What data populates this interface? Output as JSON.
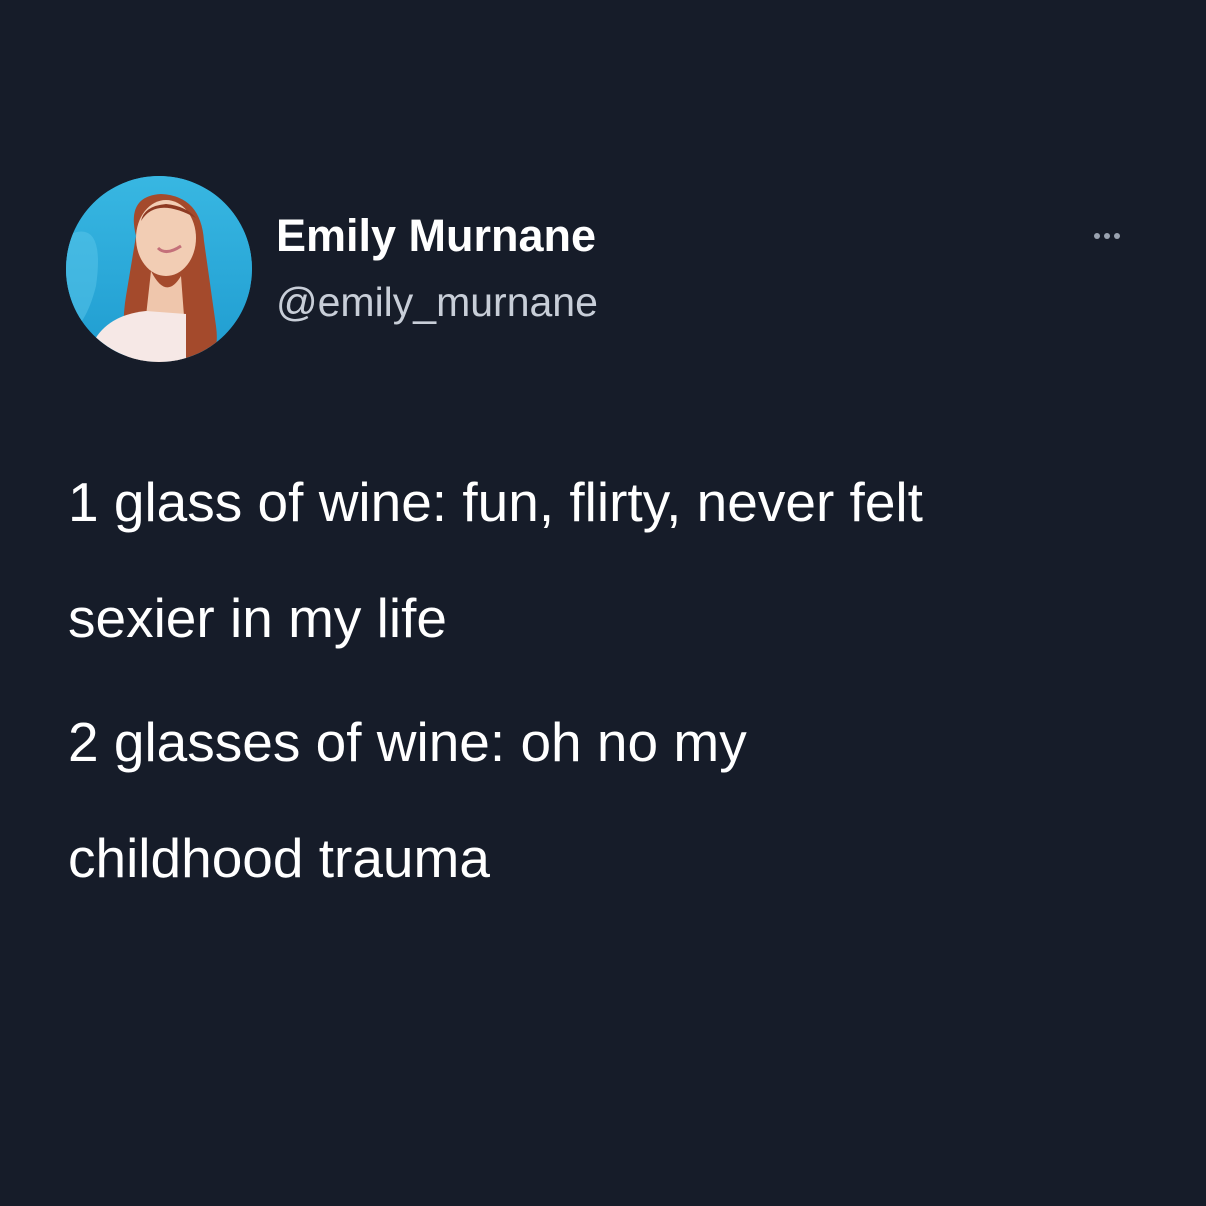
{
  "author": {
    "display_name": "Emily Murnane",
    "handle": "@emily_murnane",
    "avatar_icon": "profile-photo"
  },
  "actions": {
    "more_icon": "ellipsis-icon"
  },
  "tweet": {
    "lines": [
      "1 glass of wine: fun, flirty, never felt",
      "sexier in my life",
      "2 glasses of wine: oh no my",
      "childhood trauma"
    ]
  },
  "colors": {
    "background": "#161c29",
    "text": "#ffffff",
    "handle": "#c8ced8",
    "avatar_bg": "#2aa7d6"
  }
}
